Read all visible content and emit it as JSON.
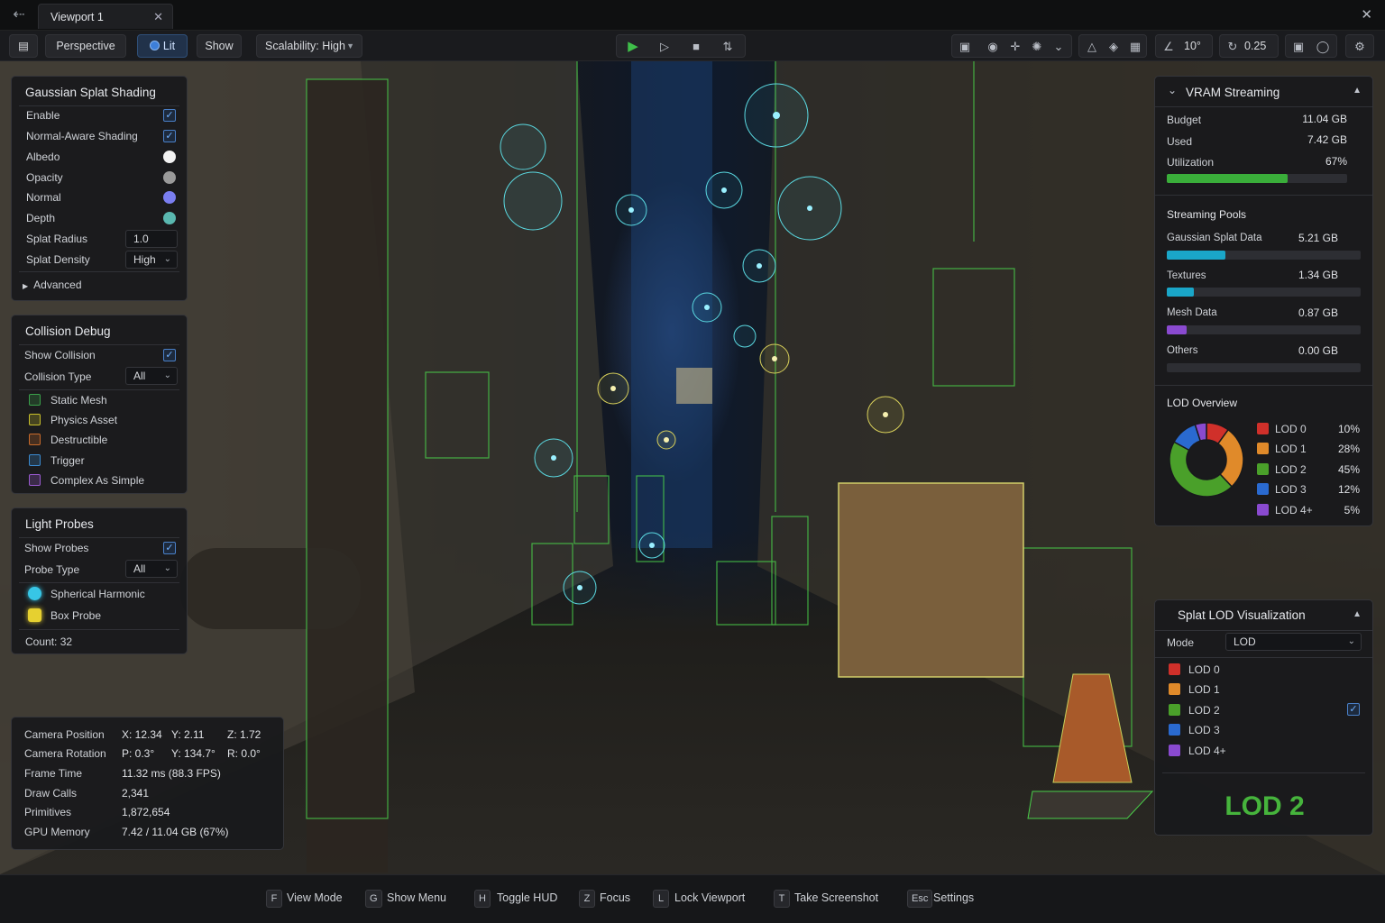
{
  "tab": {
    "title": "Viewport 1"
  },
  "toolbar": {
    "perspective": "Perspective",
    "lit": "Lit",
    "show": "Show",
    "scalability": "Scalability: High",
    "angle": "10°",
    "speed": "0.25"
  },
  "gaussian": {
    "title": "Gaussian Splat Shading",
    "enable": "Enable",
    "normal_aware": "Normal-Aware Shading",
    "albedo": "Albedo",
    "opacity": "Opacity",
    "normal": "Normal",
    "depth": "Depth",
    "splat_radius_label": "Splat Radius",
    "splat_radius": "1.0",
    "splat_density_label": "Splat Density",
    "splat_density": "High",
    "advanced": "Advanced",
    "colors": {
      "albedo": "#f2f2f2",
      "opacity": "#9a9a9a",
      "normal": "#7a7ef0",
      "depth": "#5ab8b0"
    }
  },
  "collision": {
    "title": "Collision Debug",
    "show": "Show Collision",
    "type_label": "Collision Type",
    "type": "All",
    "items": [
      {
        "label": "Static Mesh",
        "color": "#3aa04a"
      },
      {
        "label": "Physics Asset",
        "color": "#c8c02a"
      },
      {
        "label": "Destructible",
        "color": "#c86a2a"
      },
      {
        "label": "Trigger",
        "color": "#3a8ad0"
      },
      {
        "label": "Complex As Simple",
        "color": "#9a5ad0"
      }
    ]
  },
  "probes": {
    "title": "Light Probes",
    "show": "Show Probes",
    "type_label": "Probe Type",
    "type": "All",
    "spherical": "Spherical Harmonic",
    "box": "Box Probe",
    "count": "Count:  32"
  },
  "stats": {
    "camera_position": "Camera Position",
    "pos_x": "X: 12.34",
    "pos_y": "Y:  2.11",
    "pos_z": "Z:  1.72",
    "camera_rotation": "Camera Rotation",
    "rot_p": "P: 0.3°",
    "rot_y": "Y:  134.7°",
    "rot_r": "R: 0.0°",
    "frame_time": "Frame Time",
    "frame_time_val": "11.32 ms  (88.3 FPS)",
    "draw_calls": "Draw Calls",
    "draw_calls_val": "2,341",
    "primitives": "Primitives",
    "primitives_val": "1,872,654",
    "gpu_memory": "GPU Memory",
    "gpu_memory_val": "7.42 / 11.04 GB (67%)"
  },
  "vram": {
    "title": "VRAM Streaming",
    "budget": "Budget",
    "budget_val": "11.04 GB",
    "used": "Used",
    "used_val": "7.42 GB",
    "utilization": "Utilization",
    "utilization_val": "67%",
    "utilization_frac": 0.67,
    "pools_title": "Streaming Pools",
    "pools": [
      {
        "label": "Gaussian Splat Data",
        "value": "5.21 GB",
        "frac": 0.3,
        "color": "#1aa6c8"
      },
      {
        "label": "Textures",
        "value": "1.34 GB",
        "frac": 0.14,
        "color": "#1aa6c8"
      },
      {
        "label": "Mesh Data",
        "value": "0.87 GB",
        "frac": 0.1,
        "color": "#8a4ad0"
      },
      {
        "label": "Others",
        "value": "0.00 GB",
        "frac": 0.0,
        "color": "#555"
      }
    ],
    "lod_title": "LOD Overview",
    "lods": [
      {
        "label": "LOD 0",
        "pct": "10%",
        "value": 10,
        "color": "#d0302a"
      },
      {
        "label": "LOD 1",
        "pct": "28%",
        "value": 28,
        "color": "#e08a2a"
      },
      {
        "label": "LOD 2",
        "pct": "45%",
        "value": 45,
        "color": "#4aa02a"
      },
      {
        "label": "LOD 3",
        "pct": "12%",
        "value": 12,
        "color": "#2a6ad0"
      },
      {
        "label": "LOD 4+",
        "pct": "5%",
        "value": 5,
        "color": "#8a4ad0"
      }
    ]
  },
  "splat_lod": {
    "title": "Splat LOD Visualization",
    "mode_label": "Mode",
    "mode": "LOD",
    "items": [
      {
        "label": "LOD 0",
        "color": "#d0302a"
      },
      {
        "label": "LOD 1",
        "color": "#e08a2a"
      },
      {
        "label": "LOD 2",
        "color": "#4aa02a"
      },
      {
        "label": "LOD 3",
        "color": "#2a6ad0"
      },
      {
        "label": "LOD 4+",
        "color": "#8a4ad0"
      }
    ],
    "current": "LOD 2"
  },
  "shortcuts": [
    {
      "key": "F",
      "label": "View Mode"
    },
    {
      "key": "G",
      "label": "Show Menu"
    },
    {
      "key": "H",
      "label": "Toggle HUD"
    },
    {
      "key": "Z",
      "label": "Focus"
    },
    {
      "key": "L",
      "label": "Lock Viewport"
    },
    {
      "key": "T",
      "label": "Take Screenshot"
    },
    {
      "key": "Esc",
      "label": "Settings"
    }
  ]
}
